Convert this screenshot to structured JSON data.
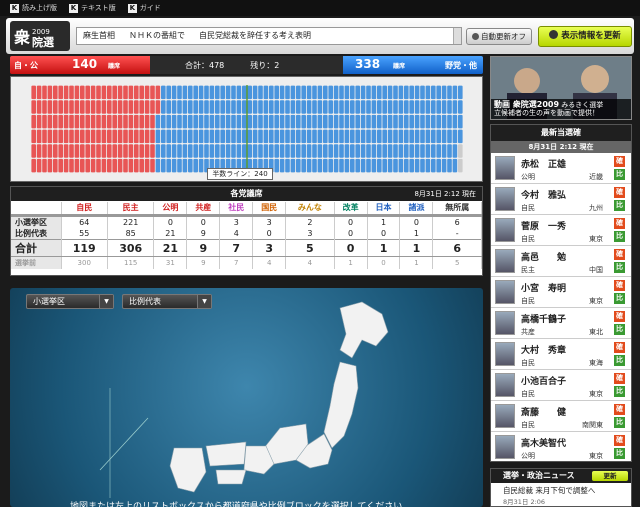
{
  "topbar": {
    "links": [
      "読み上げ版",
      "テキスト版",
      "ガイド"
    ]
  },
  "header": {
    "logo_text": "衆院選2009",
    "ticker": [
      "麻生首相",
      "ＮＨＫの番組で",
      "自民党総裁を辞任する考え表明"
    ],
    "auto_update": "自動更新オフ",
    "update_button": "表示情報を更新"
  },
  "scorebar": {
    "left_name": "自・公",
    "left_seats": "140",
    "seat_unit": "議席",
    "total_label": "合計：478",
    "remaining_label": "残り：2",
    "right_seats": "338",
    "right_name": "野党・他"
  },
  "seatmap": {
    "half_line": "半数ライン：240",
    "colors": {
      "ruling": "#e85555",
      "opposition": "#4a95de",
      "empty": "#cccccc"
    }
  },
  "party_table": {
    "title": "各党議席",
    "time": "8月31日 2:12 現在",
    "headers": [
      "",
      "自民",
      "民主",
      "公明",
      "共産",
      "社民",
      "国民",
      "みんな",
      "改革",
      "日本",
      "諸派",
      "無所属"
    ],
    "rows": [
      {
        "label": "小選挙区",
        "values": [
          "64",
          "221",
          "0",
          "0",
          "3",
          "3",
          "2",
          "0",
          "1",
          "0",
          "6"
        ]
      },
      {
        "label": "比例代表",
        "values": [
          "55",
          "85",
          "21",
          "9",
          "4",
          "0",
          "3",
          "0",
          "0",
          "1",
          "-"
        ]
      },
      {
        "label": "合計",
        "values": [
          "119",
          "306",
          "21",
          "9",
          "7",
          "3",
          "5",
          "0",
          "1",
          "1",
          "6"
        ]
      },
      {
        "label": "選挙前",
        "values": [
          "300",
          "115",
          "31",
          "9",
          "7",
          "4",
          "4",
          "1",
          "0",
          "1",
          "5"
        ]
      }
    ],
    "party_colors": {
      "自民": "#d02020",
      "民主": "#d02020",
      "公明": "#d02020",
      "共産": "#d02020",
      "社民": "#c040c0",
      "国民": "#d06000",
      "みんな": "#c08000",
      "改革": "#008060",
      "日本": "#2060c0",
      "諸派": "#2060c0",
      "無所属": "#333333"
    }
  },
  "map": {
    "select1": "小選挙区",
    "select2": "比例代表",
    "instruction": "地図または左上のリストボックスから都道府県や比例ブロックを選択してください"
  },
  "video": {
    "title": "動画 衆院選2009",
    "subtitle": "みるきく選挙",
    "caption": "立候補者の生の声を動画で提供！"
  },
  "winners": {
    "title": "最新当選確",
    "time": "8月31日 2:12 現在",
    "list": [
      {
        "name": "赤松　正雄",
        "party": "公明",
        "area": "近畿",
        "k1": "確",
        "k2": "比"
      },
      {
        "name": "今村　雅弘",
        "party": "自民",
        "area": "九州",
        "k1": "確",
        "k2": "比"
      },
      {
        "name": "菅原　一秀",
        "party": "自民",
        "area": "東京",
        "k1": "確",
        "k2": "比"
      },
      {
        "name": "高邑　　勉",
        "party": "民主",
        "area": "中国",
        "k1": "確",
        "k2": "比"
      },
      {
        "name": "小宮　寿明",
        "party": "自民",
        "area": "東京",
        "k1": "確",
        "k2": "比"
      },
      {
        "name": "高橋千鶴子",
        "party": "共産",
        "area": "東北",
        "k1": "確",
        "k2": "比"
      },
      {
        "name": "大村　秀章",
        "party": "自民",
        "area": "東海",
        "k1": "確",
        "k2": "比"
      },
      {
        "name": "小池百合子",
        "party": "自民",
        "area": "東京",
        "k1": "確",
        "k2": "比"
      },
      {
        "name": "斎藤　　健",
        "party": "自民",
        "area": "南関東",
        "k1": "確",
        "k2": "比"
      },
      {
        "name": "高木美智代",
        "party": "公明",
        "area": "東京",
        "k1": "確",
        "k2": "比"
      }
    ]
  },
  "news": {
    "title": "選挙・政治ニュース",
    "update": "更新",
    "headline": "自民総裁 来月下旬で調整へ",
    "time": "8月31日 2:06"
  }
}
